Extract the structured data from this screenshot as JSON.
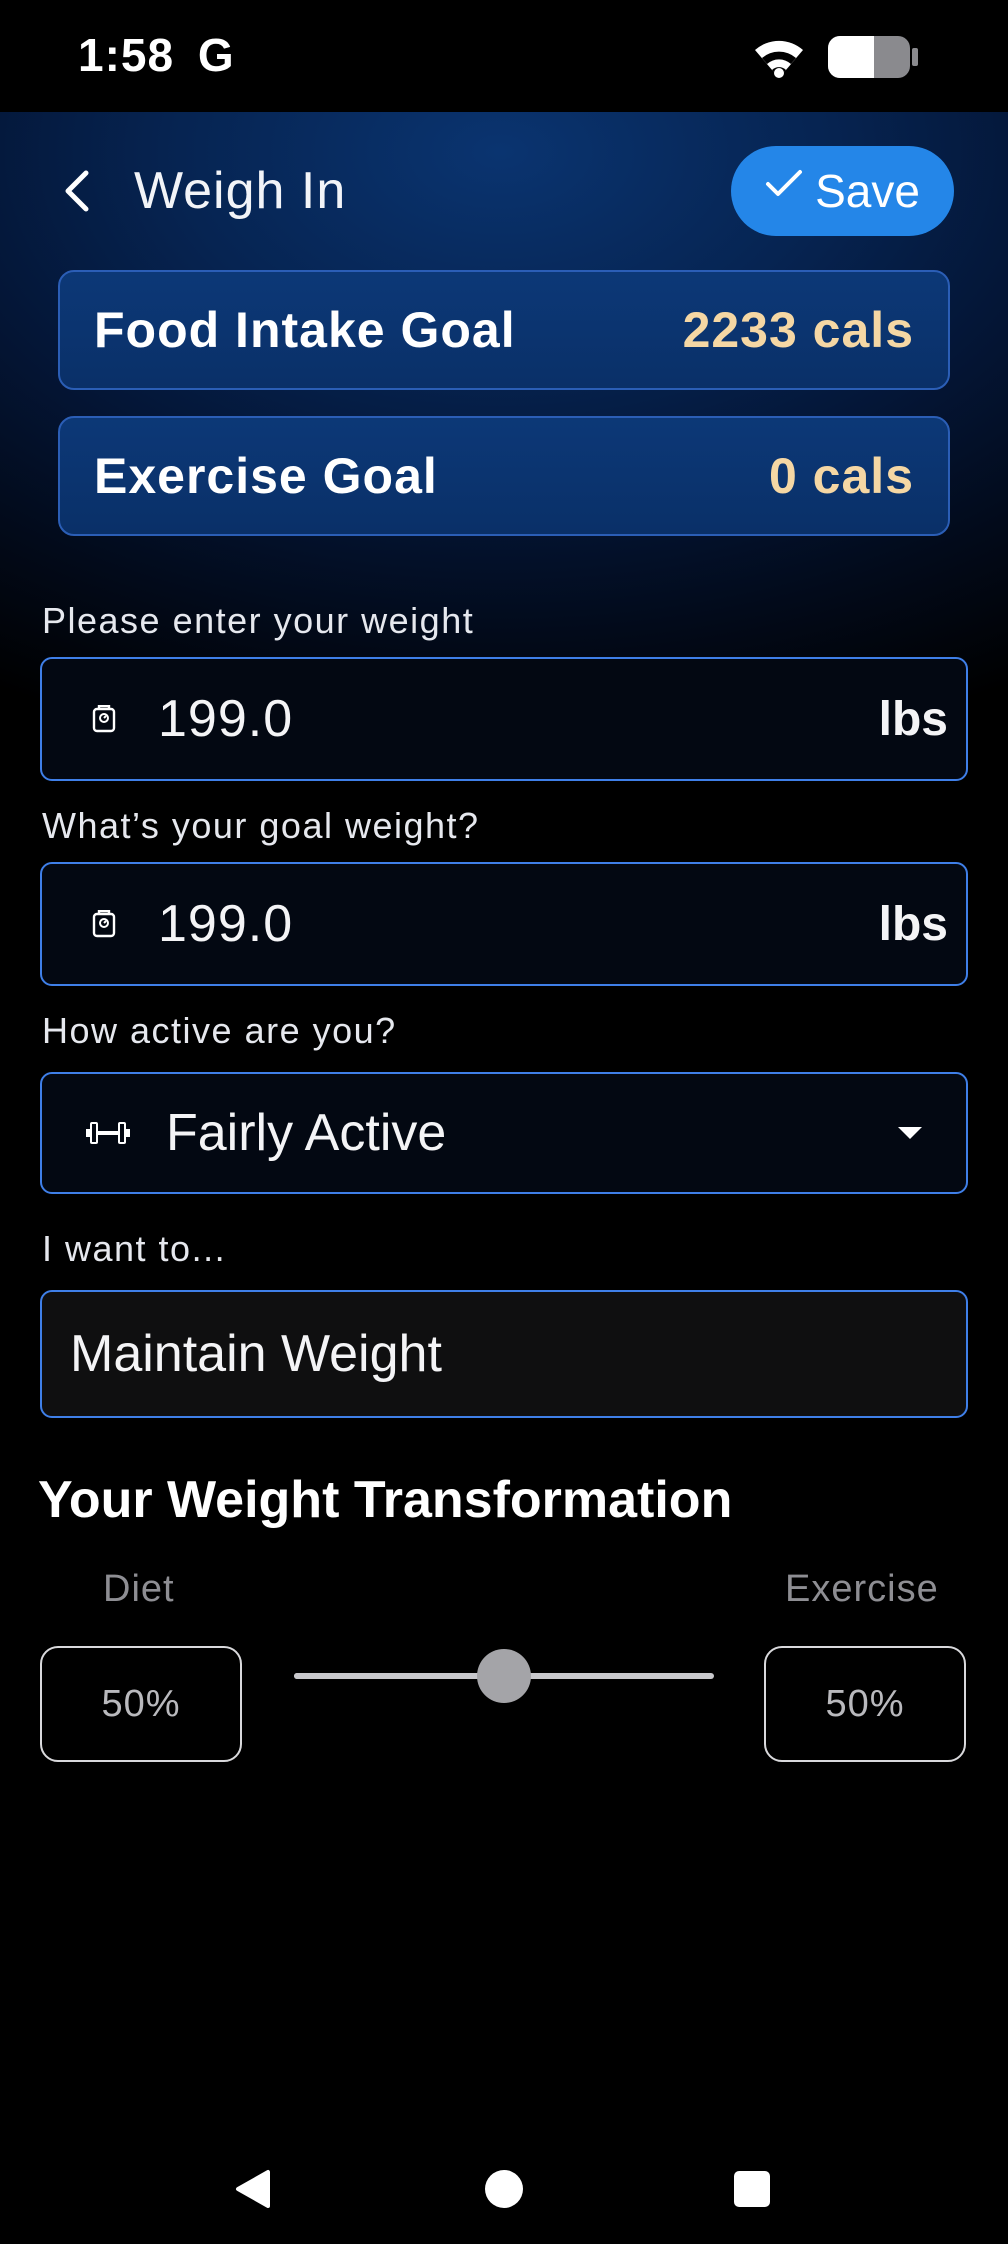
{
  "status_bar": {
    "time": "1:58",
    "carrier_glyph": "G",
    "icons": [
      "wifi-icon",
      "battery-icon"
    ]
  },
  "header": {
    "back_icon": "chevron-left-icon",
    "title": "Weigh In",
    "save_label": "Save",
    "save_icon": "check-icon",
    "accent_color": "#2486e8"
  },
  "goals": {
    "food": {
      "label": "Food Intake Goal",
      "value": "2233 cals"
    },
    "exercise": {
      "label": "Exercise Goal",
      "value": "0 cals"
    },
    "value_color": "#f5d7a4"
  },
  "weight": {
    "label": "Please enter your weight",
    "value": "199.0",
    "unit": "lbs",
    "icon": "scale-icon"
  },
  "goal_weight": {
    "label": "What’s your goal weight?",
    "value": "199.0",
    "unit": "lbs",
    "icon": "scale-icon"
  },
  "activity": {
    "label": "How active are you?",
    "value": "Fairly Active",
    "icon": "dumbbell-icon"
  },
  "intent": {
    "label": "I want to...",
    "value": "Maintain Weight"
  },
  "transformation": {
    "title": "Your Weight Transformation",
    "diet_label": "Diet",
    "exercise_label": "Exercise",
    "diet_value": "50%",
    "exercise_value": "50%",
    "slider_fraction": 0.5
  },
  "nav": {
    "icons": [
      "back-triangle-icon",
      "home-circle-icon",
      "recents-square-icon"
    ]
  }
}
